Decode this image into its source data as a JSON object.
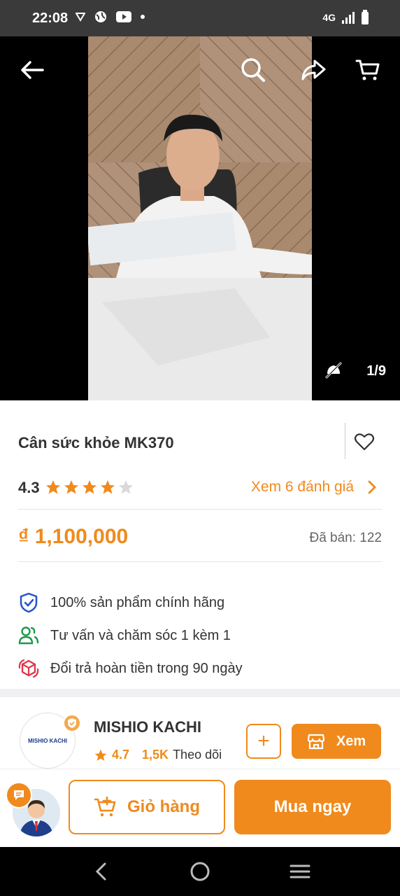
{
  "status_bar": {
    "time": "22:08",
    "network": "4G",
    "left_icons": [
      "notification-triangle-icon",
      "globe-icon",
      "youtube-icon",
      "dot-icon"
    ],
    "right_icons": [
      "signal-icon",
      "battery-icon"
    ]
  },
  "media": {
    "counter": "1/9",
    "icons": [
      "back-arrow-icon",
      "search-icon",
      "share-icon",
      "cart-icon",
      "mute-icon"
    ]
  },
  "product": {
    "title": "Cân sức khỏe MK370",
    "rating": "4.3",
    "stars_filled": 4,
    "stars_total": 5,
    "reviews_link": "Xem 6 đánh giá",
    "price": "₫ 1,100,000",
    "sold": "Đã bán: 122",
    "benefits": [
      {
        "icon": "shield-check-icon",
        "text": "100% sản phẩm chính hãng",
        "color": "#2453c6"
      },
      {
        "icon": "users-icon",
        "text": "Tư vấn và chăm sóc 1 kèm 1",
        "color": "#1e9a4b"
      },
      {
        "icon": "return-box-icon",
        "text": "Đổi trả hoàn tiền trong 90 ngày",
        "color": "#e0374a"
      }
    ]
  },
  "shop": {
    "name": "MISHIO KACHI",
    "logo_text": "MISHIO KACHI",
    "rating": "4.7",
    "followers": "1,5K",
    "followers_label": "Theo dõi",
    "follow_label": "+",
    "view_label": "Xem"
  },
  "actions": {
    "cart_label": "Giỏ hàng",
    "buy_label": "Mua ngay"
  },
  "colors": {
    "accent": "#f08a1c",
    "text": "#333333"
  }
}
